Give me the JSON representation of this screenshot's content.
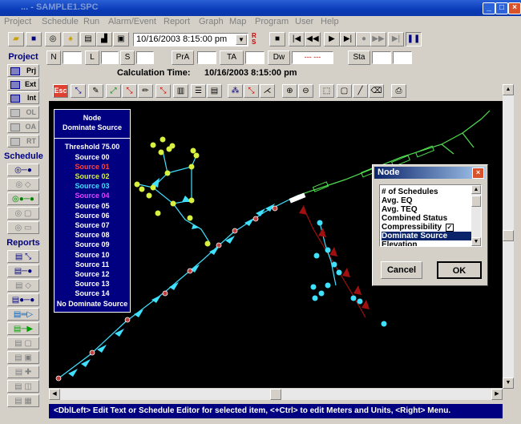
{
  "window": {
    "title": "... - SAMPLE1.SPC"
  },
  "menus": [
    "Project",
    "Schedule",
    "Run",
    "Alarm/Event",
    "Report",
    "Graph",
    "Map",
    "Program",
    "User",
    "Help"
  ],
  "toolbar": {
    "datetime": "10/16/2003 8:15:00 pm",
    "rs_letters": "RS"
  },
  "filters": {
    "n": "N",
    "l": "L",
    "s": "S",
    "pra": "PrA",
    "ta": "TA",
    "dw": "Dw",
    "dw_values": "--- ---",
    "sta": "Sta"
  },
  "calc": {
    "label": "Calculation Time:",
    "value": "10/16/2003 8:15:00 pm"
  },
  "sidebar": {
    "project_header": "Project",
    "project_items": [
      {
        "label": "Prj"
      },
      {
        "label": "Ext"
      },
      {
        "label": "Int"
      },
      {
        "label": "OL"
      },
      {
        "label": "OA"
      },
      {
        "label": "RT"
      }
    ],
    "schedule_header": "Schedule",
    "reports_header": "Reports"
  },
  "map_toolbar": {
    "esc_label": "Esc"
  },
  "legend": {
    "title1": "Node",
    "title2": "Dominate Source",
    "threshold": "Threshold 75.00",
    "items": [
      {
        "label": "Source 00",
        "color": "#ffffff"
      },
      {
        "label": "Source 01",
        "color": "#ff4040"
      },
      {
        "label": "Source 02",
        "color": "#d8f040"
      },
      {
        "label": "Source 03",
        "color": "#40e0ff"
      },
      {
        "label": "Source 04",
        "color": "#e040ff"
      },
      {
        "label": "Source 05",
        "color": "#ffffff"
      },
      {
        "label": "Source 06",
        "color": "#ffffff"
      },
      {
        "label": "Source 07",
        "color": "#ffffff"
      },
      {
        "label": "Source 08",
        "color": "#ffffff"
      },
      {
        "label": "Source 09",
        "color": "#ffffff"
      },
      {
        "label": "Source 10",
        "color": "#ffffff"
      },
      {
        "label": "Source 11",
        "color": "#ffffff"
      },
      {
        "label": "Source 12",
        "color": "#ffffff"
      },
      {
        "label": "Source 13",
        "color": "#ffffff"
      },
      {
        "label": "Source 14",
        "color": "#ffffff"
      }
    ],
    "none": "No Dominate Source"
  },
  "node_dialog": {
    "title": "Node",
    "items": [
      {
        "label": "# of Schedules",
        "selected": false
      },
      {
        "label": "Avg. EQ",
        "selected": false
      },
      {
        "label": "Avg. TEQ",
        "selected": false
      },
      {
        "label": "Combined Status",
        "selected": false
      },
      {
        "label": "Compressibility",
        "selected": false,
        "checked": true
      },
      {
        "label": "Dominate Source",
        "selected": true
      },
      {
        "label": "Elevation",
        "selected": false
      }
    ],
    "cancel": "Cancel",
    "ok": "OK"
  },
  "status": "<DblLeft> Edit Text or Schedule Editor for selected item, <+Ctrl> to edit Meters and Units, <Right> Menu.",
  "colors": {
    "pipe_blue": "#40e0ff",
    "pipe_green": "#50e050",
    "node_yellow": "#d8f040",
    "node_red": "#c04040",
    "arrow_dark_red": "#a01010"
  }
}
